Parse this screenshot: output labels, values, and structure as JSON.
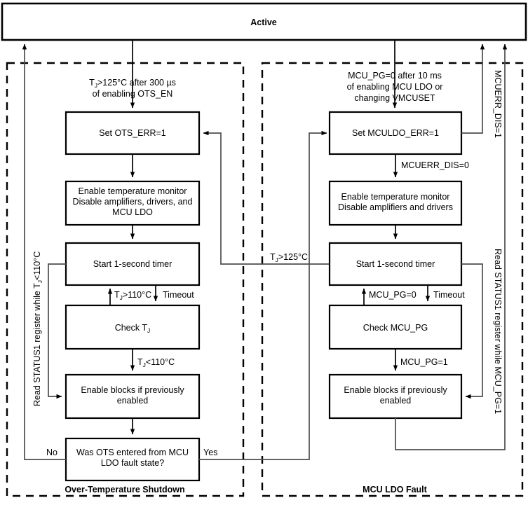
{
  "diagram": {
    "title": "Active state / fault state machine flowchart",
    "top_state": {
      "label": "Active"
    },
    "groups": [
      {
        "id": "ots",
        "label": "Over-Temperature Shutdown"
      },
      {
        "id": "mculdo",
        "label": "MCU LDO Fault"
      }
    ],
    "left_column": {
      "entry_label_line1": "T",
      "entry_label_sub": "J",
      "entry_label_line1b": ">125°C after 300 µs",
      "entry_label_line2": "of enabling OTS_EN",
      "boxes": [
        {
          "id": "set-ots-err",
          "label": "Set OTS_ERR=1"
        },
        {
          "id": "enable-temp-monitor",
          "line1": "Enable temperature monitor",
          "line2": "Disable amplifiers, drivers, and",
          "line3": "MCU LDO"
        },
        {
          "id": "start-timer",
          "label": "Start 1-second timer"
        },
        {
          "id": "check-tj",
          "label": "Check T",
          "sub": "J"
        },
        {
          "id": "enable-blocks",
          "line1": "Enable blocks if previously",
          "line2": "enabled"
        },
        {
          "id": "was-ots-entered",
          "line1": "Was OTS entered from MCU",
          "line2": "LDO fault state?"
        }
      ],
      "edge_labels": {
        "tj_gt_110": ">110°C",
        "tj_gt_110_prefix": "T",
        "tj_gt_110_sub": "J",
        "timeout": "Timeout",
        "tj_lt_110": "<110°C",
        "tj_lt_110_prefix": "T",
        "tj_lt_110_sub": "J",
        "no": "No",
        "yes": "Yes"
      },
      "side_label": {
        "prefix": "Read STATUS1 register while T",
        "sub": "J",
        "suffix": "<110°C"
      }
    },
    "right_column": {
      "entry_label_line1": "MCU_PG=0 after 10 ms",
      "entry_label_line2": "of enabling MCU LDO or",
      "entry_label_line3": "changing VMCUSET",
      "boxes": [
        {
          "id": "set-mculdo-err",
          "label": "Set MCULDO_ERR=1"
        },
        {
          "id": "enable-temp-monitor-2",
          "line1": "Enable temperature monitor",
          "line2": "Disable amplifiers and drivers"
        },
        {
          "id": "start-timer-2",
          "label": "Start 1-second timer"
        },
        {
          "id": "check-mcu-pg",
          "label": "Check MCU_PG"
        },
        {
          "id": "enable-blocks-2",
          "line1": "Enable blocks if previously",
          "line2": "enabled"
        }
      ],
      "edge_labels": {
        "mcuerr_dis_0": "MCUERR_DIS=0",
        "mcu_pg_0": "MCU_PG=0",
        "timeout": "Timeout",
        "mcu_pg_1": "MCU_PG=1"
      },
      "side_labels": {
        "mcuerr_dis_1": "MCUERR_DIS=1",
        "read_status": "Read STATUS1 register while MCU_PG=1"
      }
    },
    "cross_link": {
      "prefix": "T",
      "sub": "J",
      "suffix": ">125°C"
    },
    "colors": {
      "line": "#4d4d4d",
      "box_border": "#000000",
      "background": "#ffffff",
      "text": "#000000"
    }
  }
}
